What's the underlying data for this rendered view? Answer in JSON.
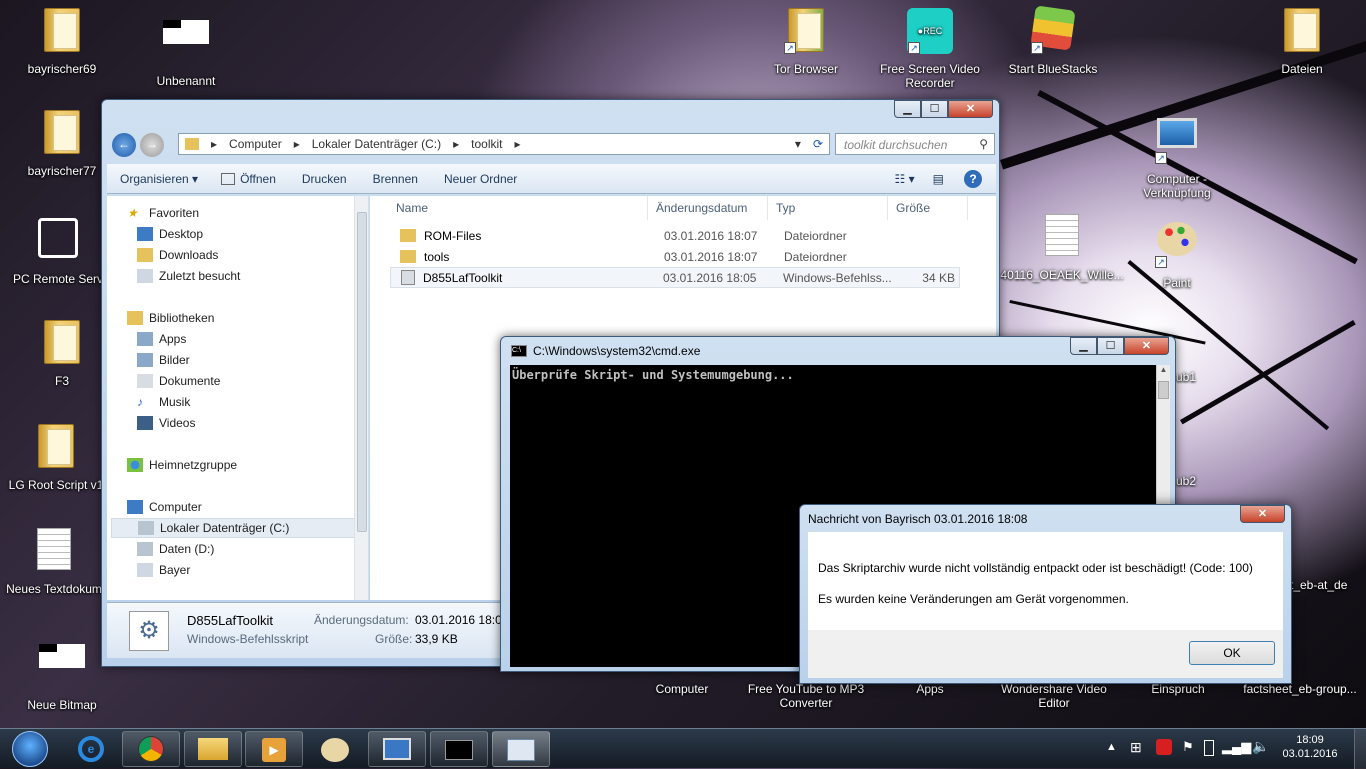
{
  "desktop": {
    "icons": [
      {
        "label": "bayrischer69",
        "kind": "folder"
      },
      {
        "label": "Unbenannt",
        "kind": "bitmap"
      },
      {
        "label": "Tor Browser",
        "kind": "folder-shortcut"
      },
      {
        "label": "Free Screen Video Recorder",
        "kind": "app-shortcut"
      },
      {
        "label": "Start BlueStacks",
        "kind": "app-shortcut"
      },
      {
        "label": "Dateien",
        "kind": "folder"
      },
      {
        "label": "bayrischer77",
        "kind": "folder"
      },
      {
        "label": "Computer - Verknüpfung",
        "kind": "shortcut"
      },
      {
        "label": "PC Remote Serv",
        "kind": "app"
      },
      {
        "label": "40116_OEAEK_Wille...",
        "kind": "pdf"
      },
      {
        "label": "Paint",
        "kind": "app-shortcut"
      },
      {
        "label": "F3",
        "kind": "folder"
      },
      {
        "label": "LG Root Script v1",
        "kind": "folder"
      },
      {
        "label": "Neues Textdokum",
        "kind": "text"
      },
      {
        "label": "Neue Bitmap",
        "kind": "bitmap"
      },
      {
        "label": "ub1",
        "kind": "partial"
      },
      {
        "label": "ub2",
        "kind": "partial"
      },
      {
        "label": "t_eb-at_de",
        "kind": "pdf"
      },
      {
        "label": "Computer",
        "kind": "partial"
      },
      {
        "label": "Free YouTube to MP3 Converter",
        "kind": "partial"
      },
      {
        "label": "Apps",
        "kind": "partial"
      },
      {
        "label": "Wondershare Video Editor",
        "kind": "partial"
      },
      {
        "label": "Einspruch",
        "kind": "partial"
      },
      {
        "label": "factsheet_eb-group...",
        "kind": "pdf"
      }
    ]
  },
  "explorer": {
    "breadcrumb": [
      "Computer",
      "Lokaler Datenträger (C:)",
      "toolkit"
    ],
    "search_placeholder": "toolkit durchsuchen",
    "toolbar": [
      "Organisieren ▾",
      "Öffnen",
      "Drucken",
      "Brennen",
      "Neuer Ordner"
    ],
    "nav": {
      "favorites_header": "Favoriten",
      "favorites": [
        "Desktop",
        "Downloads",
        "Zuletzt besucht"
      ],
      "libraries_header": "Bibliotheken",
      "libraries": [
        "Apps",
        "Bilder",
        "Dokumente",
        "Musik",
        "Videos"
      ],
      "homegroup": "Heimnetzgruppe",
      "computer_header": "Computer",
      "drives": [
        "Lokaler Datenträger (C:)",
        "Daten (D:)",
        "Bayer"
      ]
    },
    "columns": [
      "Name",
      "Änderungsdatum",
      "Typ",
      "Größe"
    ],
    "files": [
      {
        "name": "ROM-Files",
        "date": "03.01.2016 18:07",
        "type": "Dateiordner",
        "size": ""
      },
      {
        "name": "tools",
        "date": "03.01.2016 18:07",
        "type": "Dateiordner",
        "size": ""
      },
      {
        "name": "D855LafToolkit",
        "date": "03.01.2016 18:05",
        "type": "Windows-Befehlss...",
        "size": "34 KB"
      }
    ],
    "details": {
      "name": "D855LafToolkit",
      "type": "Windows-Befehlsskript",
      "date_label": "Änderungsdatum:",
      "date_value": "03.01.2016 18:05",
      "size_label": "Größe:",
      "size_value": "33,9 KB"
    }
  },
  "cmd": {
    "title": "C:\\Windows\\system32\\cmd.exe",
    "output": "Überprüfe Skript- und Systemumgebung..."
  },
  "message": {
    "title": "Nachricht von Bayrisch 03.01.2016 18:08",
    "line1": "Das Skriptarchiv wurde nicht vollständig entpackt oder ist beschädigt! (Code: 100)",
    "line2": "Es wurden keine Veränderungen am Gerät vorgenommen.",
    "ok": "OK"
  },
  "taskbar": {
    "apps": [
      "internet-explorer",
      "chrome",
      "explorer",
      "media-player",
      "paint",
      "remote-desktop",
      "cmd",
      "message"
    ],
    "time": "18:09",
    "date": "03.01.2016"
  },
  "colors": {
    "accent": "#1e395b",
    "selection": "#cce8ff"
  }
}
